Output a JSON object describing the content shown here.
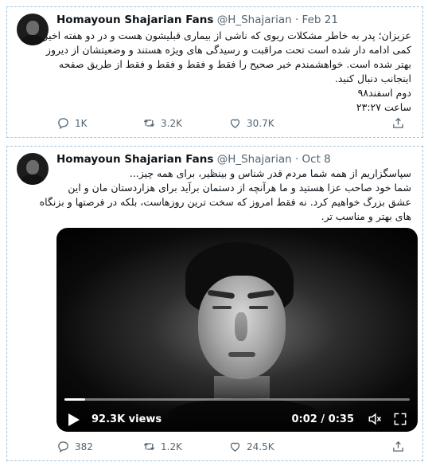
{
  "tweets": [
    {
      "author_name": "Homayoun Shajarian Fans",
      "handle": "@H_Shajarian",
      "separator": "·",
      "date": "Feb 21",
      "lines": [
        "عزیزان؛ پدر به خاطر مشکلات ریوی که ناشی از بیماری قبلیشون هست و در دو هفته اخیر",
        "کمی ادامه دار شده است تحت مراقبت و رسیدگی های ویژه هستند و وضعیتشان از دیروز",
        "بهتر شده است. خواهشمندم خبر صحیح را فقط و فقط و فقط و فقط از طریق صفحه",
        "اینجانب دنبال کنید.",
        "دوم اسفند۹۸",
        "ساعت ۲۳:۲۷"
      ],
      "replies": "1K",
      "retweets": "3.2K",
      "likes": "30.7K"
    },
    {
      "author_name": "Homayoun Shajarian Fans",
      "handle": "@H_Shajarian",
      "separator": "·",
      "date": "Oct 8",
      "lines": [
        "سپاسگزاریم از همه شما مردم قدر شناس و بینظیر، برای همه چیز...",
        "شما خود صاحب عزا هستید و ما هرآنچه از دستمان برآید برای هزاردستان مان و این",
        "عشق بزرگ خواهیم کرد. نه فقط امروز که سخت ترین روزهاست، بلکه در فرصتها و بزنگاه",
        "های بهتر و مناسب تر."
      ],
      "video": {
        "views": "92.3K views",
        "time": "0:02 / 0:35",
        "progress": 0.06
      },
      "replies": "382",
      "retweets": "1.2K",
      "likes": "24.5K"
    }
  ],
  "icons": {
    "reply": "reply-icon",
    "retweet": "retweet-icon",
    "like": "like-icon",
    "share": "share-icon",
    "play": "play-icon",
    "volume": "volume-icon",
    "fullscreen": "fullscreen-icon"
  },
  "colors": {
    "text": "#0f1419",
    "muted": "#536471",
    "card_border": "#9fc4de"
  }
}
